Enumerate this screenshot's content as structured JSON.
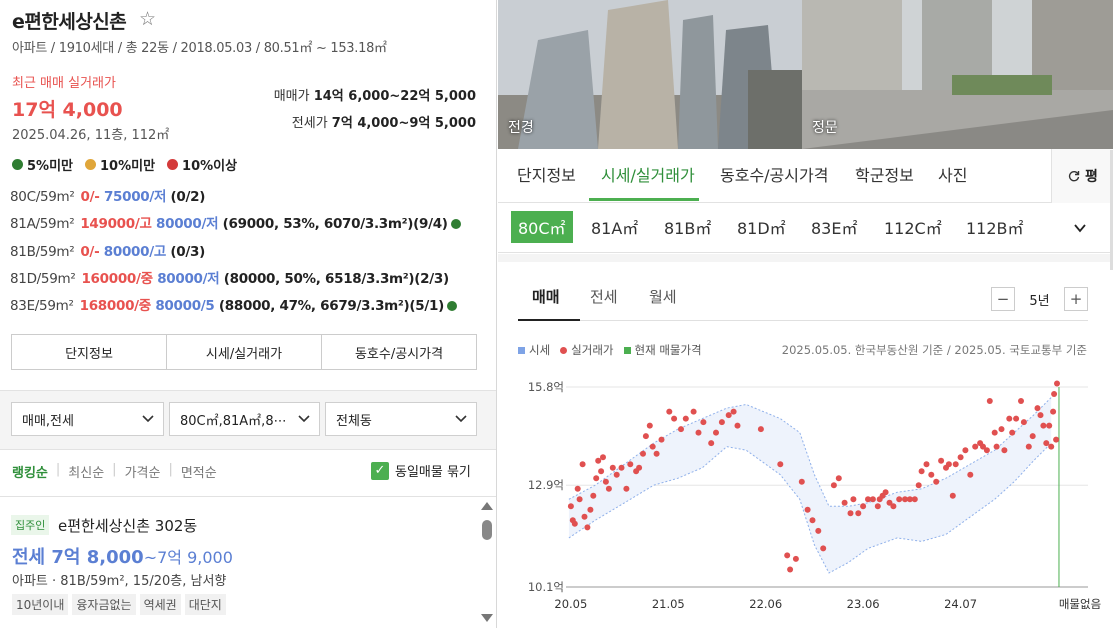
{
  "complex": {
    "title": "e편한세상신촌",
    "subtitle": "아파트 / 1910세대 / 총 22동 / 2018.05.03 / 80.51㎡ ~ 153.18㎡",
    "recent_label": "최근 매매 실거래가",
    "recent_price": "17억 4,000",
    "recent_date": "2025.04.26, 11층, 112㎡",
    "sale_range_label": "매매가 ",
    "sale_range_value": "14억 6,000~22억 5,000",
    "jeonse_range_label": "전세가 ",
    "jeonse_range_value": "7억 4,000~9억 5,000"
  },
  "ratio_legend": [
    {
      "label": "5%미만",
      "color": "#2f7d32"
    },
    {
      "label": "10%미만",
      "color": "#e0a63a"
    },
    {
      "label": "10%이상",
      "color": "#d43a3a"
    }
  ],
  "area_rows": [
    {
      "area": "80C/59m²",
      "sale": "0/- ",
      "jeonse": "75000/저",
      "detail": " (0/2)",
      "dot": false
    },
    {
      "area": "81A/59m²",
      "sale": "149000/고 ",
      "jeonse": "80000/저",
      "detail": " (69000, 53%, 6070/3.3m²)(9/4)",
      "dot": true
    },
    {
      "area": "81B/59m²",
      "sale": "0/- ",
      "jeonse": "80000/고",
      "detail": " (0/3)",
      "dot": false
    },
    {
      "area": "81D/59m²",
      "sale": "160000/중 ",
      "jeonse": "80000/저",
      "detail": " (80000, 50%, 6518/3.3m²)(2/3)",
      "dot": false
    },
    {
      "area": "83E/59m²",
      "sale": "168000/중 ",
      "jeonse": "80000/5",
      "detail": " (88000, 47%, 6679/3.3m²)(5/1)",
      "dot": true
    }
  ],
  "left_tabs": [
    "단지정보",
    "시세/실거래가",
    "동호수/공시가격"
  ],
  "filters": {
    "trade_type": "매매,전세",
    "areas": "80C㎡,81A㎡,8⋯",
    "dong": "전체동"
  },
  "sort": {
    "options": [
      "랭킹순",
      "최신순",
      "가격순",
      "면적순"
    ],
    "group_same": "동일매물 묶기"
  },
  "listing": {
    "badge": "집주인",
    "name": "e편한세상신촌 302동",
    "price_main": "전세 7억 8,000",
    "price_sub": "~7억 9,000",
    "info": "아파트 · 81B/59m², 15/20층, 남서향",
    "tags": [
      "10년이내",
      "융자금없는",
      "역세권",
      "대단지"
    ]
  },
  "photos": [
    {
      "caption": "전경"
    },
    {
      "caption": "정문"
    }
  ],
  "right_tabs": [
    "단지정보",
    "시세/실거래가",
    "동호수/공시가격",
    "학군정보",
    "사진"
  ],
  "refresh_label": "평",
  "sizes": [
    "80C㎡",
    "81A㎡",
    "81B㎡",
    "81D㎡",
    "83E㎡",
    "112C㎡",
    "112B㎡"
  ],
  "trade_tabs": [
    "매매",
    "전세",
    "월세"
  ],
  "period": "5년",
  "chart_legend": [
    {
      "label": "시세",
      "color": "#7ea3e6"
    },
    {
      "label": "실거래가",
      "color": "#e05050"
    },
    {
      "label": "현재 매물가격",
      "color": "#4caf50"
    }
  ],
  "chart_note": "2025.05.05. 한국부동산원 기준 / 2025.05. 국토교통부 기준",
  "chart_data": {
    "type": "scatter",
    "y_unit": "억",
    "ylim": [
      10.1,
      15.8
    ],
    "y_ticks": [
      "15.8억",
      "12.9억",
      "10.1억"
    ],
    "x_ticks": [
      "20.05",
      "21.05",
      "22.06",
      "23.06",
      "24.07",
      "매물없음"
    ],
    "xlim": [
      2020.3,
      2025.35
    ],
    "series": [
      {
        "name": "시세",
        "band_lower": [
          [
            2020.33,
            11.5
          ],
          [
            2020.6,
            12.0
          ],
          [
            2020.9,
            12.5
          ],
          [
            2021.2,
            13.0
          ],
          [
            2021.45,
            13.2
          ],
          [
            2021.7,
            13.5
          ],
          [
            2021.95,
            14.1
          ],
          [
            2022.15,
            14.0
          ],
          [
            2022.5,
            13.3
          ],
          [
            2022.7,
            12.6
          ],
          [
            2022.85,
            11.3
          ],
          [
            2023.0,
            10.5
          ],
          [
            2023.2,
            10.8
          ],
          [
            2023.4,
            11.2
          ],
          [
            2023.7,
            11.5
          ],
          [
            2023.95,
            11.4
          ],
          [
            2024.2,
            11.6
          ],
          [
            2024.45,
            12.1
          ],
          [
            2024.7,
            12.6
          ],
          [
            2024.9,
            13.1
          ],
          [
            2025.1,
            13.7
          ],
          [
            2025.28,
            14.2
          ]
        ],
        "band_upper": [
          [
            2020.33,
            12.6
          ],
          [
            2020.6,
            13.0
          ],
          [
            2020.9,
            13.6
          ],
          [
            2021.2,
            14.2
          ],
          [
            2021.45,
            14.6
          ],
          [
            2021.7,
            14.9
          ],
          [
            2021.95,
            15.2
          ],
          [
            2022.15,
            15.3
          ],
          [
            2022.5,
            14.9
          ],
          [
            2022.7,
            14.5
          ],
          [
            2022.85,
            13.3
          ],
          [
            2023.0,
            12.4
          ],
          [
            2023.2,
            12.4
          ],
          [
            2023.4,
            12.5
          ],
          [
            2023.7,
            12.8
          ],
          [
            2023.95,
            12.9
          ],
          [
            2024.2,
            13.2
          ],
          [
            2024.45,
            13.6
          ],
          [
            2024.7,
            14.0
          ],
          [
            2024.9,
            14.5
          ],
          [
            2025.1,
            15.0
          ],
          [
            2025.28,
            15.5
          ]
        ]
      },
      {
        "name": "실거래가",
        "points": [
          [
            2020.35,
            12.4
          ],
          [
            2020.37,
            12.0
          ],
          [
            2020.39,
            11.9
          ],
          [
            2020.42,
            12.9
          ],
          [
            2020.44,
            12.6
          ],
          [
            2020.47,
            13.6
          ],
          [
            2020.49,
            12.1
          ],
          [
            2020.52,
            11.8
          ],
          [
            2020.55,
            12.3
          ],
          [
            2020.58,
            12.7
          ],
          [
            2020.61,
            13.2
          ],
          [
            2020.63,
            13.7
          ],
          [
            2020.66,
            13.4
          ],
          [
            2020.68,
            13.8
          ],
          [
            2020.71,
            13.1
          ],
          [
            2020.74,
            12.9
          ],
          [
            2020.78,
            13.5
          ],
          [
            2020.82,
            13.3
          ],
          [
            2020.87,
            13.5
          ],
          [
            2020.92,
            12.9
          ],
          [
            2020.96,
            13.6
          ],
          [
            2021.02,
            13.4
          ],
          [
            2021.05,
            13.5
          ],
          [
            2021.09,
            13.9
          ],
          [
            2021.12,
            14.4
          ],
          [
            2021.16,
            14.7
          ],
          [
            2021.19,
            14.1
          ],
          [
            2021.23,
            13.9
          ],
          [
            2021.28,
            14.3
          ],
          [
            2021.36,
            15.1
          ],
          [
            2021.41,
            14.9
          ],
          [
            2021.48,
            14.6
          ],
          [
            2021.53,
            14.9
          ],
          [
            2021.61,
            15.1
          ],
          [
            2021.66,
            14.5
          ],
          [
            2021.71,
            14.8
          ],
          [
            2021.79,
            14.2
          ],
          [
            2021.84,
            14.5
          ],
          [
            2021.9,
            14.8
          ],
          [
            2021.97,
            15.0
          ],
          [
            2022.02,
            15.1
          ],
          [
            2022.06,
            14.7
          ],
          [
            2022.3,
            14.6
          ],
          [
            2022.5,
            13.6
          ],
          [
            2022.57,
            11.0
          ],
          [
            2022.6,
            10.6
          ],
          [
            2022.66,
            10.9
          ],
          [
            2022.72,
            13.1
          ],
          [
            2022.78,
            12.3
          ],
          [
            2022.83,
            12.0
          ],
          [
            2022.89,
            11.7
          ],
          [
            2022.94,
            11.2
          ],
          [
            2023.05,
            13.0
          ],
          [
            2023.1,
            13.2
          ],
          [
            2023.16,
            12.5
          ],
          [
            2023.22,
            12.2
          ],
          [
            2023.25,
            12.6
          ],
          [
            2023.3,
            12.2
          ],
          [
            2023.35,
            12.4
          ],
          [
            2023.4,
            12.6
          ],
          [
            2023.45,
            12.6
          ],
          [
            2023.5,
            12.4
          ],
          [
            2023.52,
            12.6
          ],
          [
            2023.55,
            12.7
          ],
          [
            2023.58,
            12.8
          ],
          [
            2023.62,
            12.5
          ],
          [
            2023.66,
            12.4
          ],
          [
            2023.72,
            12.6
          ],
          [
            2023.78,
            12.6
          ],
          [
            2023.83,
            12.6
          ],
          [
            2023.88,
            12.6
          ],
          [
            2023.92,
            13.0
          ],
          [
            2023.95,
            13.4
          ],
          [
            2024.0,
            13.6
          ],
          [
            2024.05,
            13.3
          ],
          [
            2024.1,
            13.1
          ],
          [
            2024.15,
            13.7
          ],
          [
            2024.2,
            13.5
          ],
          [
            2024.23,
            13.6
          ],
          [
            2024.27,
            12.7
          ],
          [
            2024.3,
            13.6
          ],
          [
            2024.35,
            13.8
          ],
          [
            2024.4,
            14.0
          ],
          [
            2024.45,
            13.3
          ],
          [
            2024.5,
            14.1
          ],
          [
            2024.55,
            14.2
          ],
          [
            2024.58,
            14.1
          ],
          [
            2024.62,
            14.0
          ],
          [
            2024.65,
            15.4
          ],
          [
            2024.7,
            14.5
          ],
          [
            2024.72,
            14.1
          ],
          [
            2024.77,
            14.6
          ],
          [
            2024.8,
            14.0
          ],
          [
            2024.85,
            14.9
          ],
          [
            2024.88,
            14.5
          ],
          [
            2024.92,
            14.9
          ],
          [
            2024.97,
            15.4
          ],
          [
            2025.0,
            14.8
          ],
          [
            2025.05,
            14.1
          ],
          [
            2025.09,
            14.4
          ],
          [
            2025.14,
            15.2
          ],
          [
            2025.17,
            15.0
          ],
          [
            2025.2,
            14.7
          ],
          [
            2025.23,
            14.2
          ],
          [
            2025.26,
            14.7
          ],
          [
            2025.28,
            14.1
          ],
          [
            2025.3,
            15.1
          ],
          [
            2025.31,
            15.6
          ],
          [
            2025.33,
            14.3
          ],
          [
            2025.34,
            15.9
          ]
        ]
      },
      {
        "name": "현재 매물가격",
        "x": 2025.36
      }
    ]
  }
}
